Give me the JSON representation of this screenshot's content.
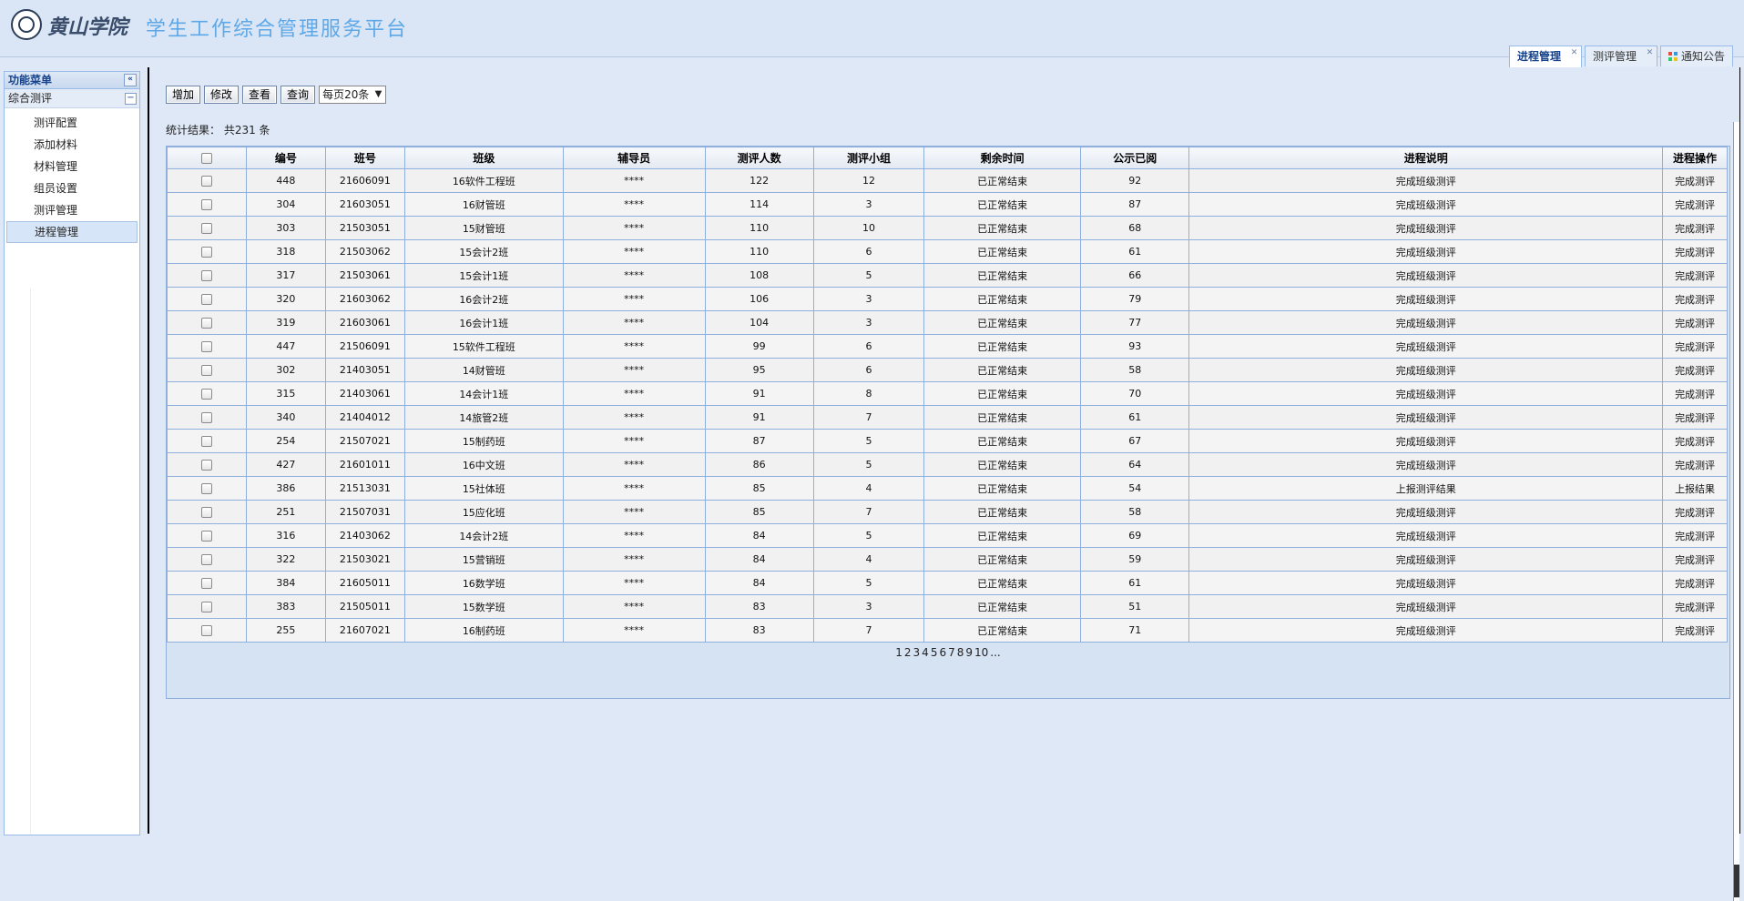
{
  "header": {
    "logo_text": "黄山学院",
    "title": "学生工作综合管理服务平台"
  },
  "tabs": [
    {
      "label": "进程管理",
      "active": true
    },
    {
      "label": "测评管理",
      "active": false
    },
    {
      "label": "通知公告",
      "active": false
    }
  ],
  "sidebar": {
    "title": "功能菜单",
    "group": "综合测评",
    "items": [
      {
        "label": "测评配置"
      },
      {
        "label": "添加材料"
      },
      {
        "label": "材料管理"
      },
      {
        "label": "组员设置"
      },
      {
        "label": "测评管理"
      },
      {
        "label": "进程管理"
      }
    ]
  },
  "toolbar": {
    "add_label": "增加",
    "edit_label": "修改",
    "view_label": "查看",
    "query_label": "查询",
    "page_size": "每页20条"
  },
  "stats": "统计结果： 共231 条",
  "table": {
    "columns": [
      "",
      "编号",
      "班号",
      "班级",
      "辅导员",
      "测评人数",
      "测评小组",
      "剩余时间",
      "公示已阅",
      "进程说明",
      "进程操作"
    ],
    "rows": [
      [
        "448",
        "21606091",
        "16软件工程班",
        "****",
        "122",
        "12",
        "已正常结束",
        "92",
        "完成班级测评",
        "完成测评"
      ],
      [
        "304",
        "21603051",
        "16财管班",
        "****",
        "114",
        "3",
        "已正常结束",
        "87",
        "完成班级测评",
        "完成测评"
      ],
      [
        "303",
        "21503051",
        "15财管班",
        "****",
        "110",
        "10",
        "已正常结束",
        "68",
        "完成班级测评",
        "完成测评"
      ],
      [
        "318",
        "21503062",
        "15会计2班",
        "****",
        "110",
        "6",
        "已正常结束",
        "61",
        "完成班级测评",
        "完成测评"
      ],
      [
        "317",
        "21503061",
        "15会计1班",
        "****",
        "108",
        "5",
        "已正常结束",
        "66",
        "完成班级测评",
        "完成测评"
      ],
      [
        "320",
        "21603062",
        "16会计2班",
        "****",
        "106",
        "3",
        "已正常结束",
        "79",
        "完成班级测评",
        "完成测评"
      ],
      [
        "319",
        "21603061",
        "16会计1班",
        "****",
        "104",
        "3",
        "已正常结束",
        "77",
        "完成班级测评",
        "完成测评"
      ],
      [
        "447",
        "21506091",
        "15软件工程班",
        "****",
        "99",
        "6",
        "已正常结束",
        "93",
        "完成班级测评",
        "完成测评"
      ],
      [
        "302",
        "21403051",
        "14财管班",
        "****",
        "95",
        "6",
        "已正常结束",
        "58",
        "完成班级测评",
        "完成测评"
      ],
      [
        "315",
        "21403061",
        "14会计1班",
        "****",
        "91",
        "8",
        "已正常结束",
        "70",
        "完成班级测评",
        "完成测评"
      ],
      [
        "340",
        "21404012",
        "14旅管2班",
        "****",
        "91",
        "7",
        "已正常结束",
        "61",
        "完成班级测评",
        "完成测评"
      ],
      [
        "254",
        "21507021",
        "15制药班",
        "****",
        "87",
        "5",
        "已正常结束",
        "67",
        "完成班级测评",
        "完成测评"
      ],
      [
        "427",
        "21601011",
        "16中文班",
        "****",
        "86",
        "5",
        "已正常结束",
        "64",
        "完成班级测评",
        "完成测评"
      ],
      [
        "386",
        "21513031",
        "15社体班",
        "****",
        "85",
        "4",
        "已正常结束",
        "54",
        "上报测评结果",
        "上报结果"
      ],
      [
        "251",
        "21507031",
        "15应化班",
        "****",
        "85",
        "7",
        "已正常结束",
        "58",
        "完成班级测评",
        "完成测评"
      ],
      [
        "316",
        "21403062",
        "14会计2班",
        "****",
        "84",
        "5",
        "已正常结束",
        "69",
        "完成班级测评",
        "完成测评"
      ],
      [
        "322",
        "21503021",
        "15营销班",
        "****",
        "84",
        "4",
        "已正常结束",
        "59",
        "完成班级测评",
        "完成测评"
      ],
      [
        "384",
        "21605011",
        "16数学班",
        "****",
        "84",
        "5",
        "已正常结束",
        "61",
        "完成班级测评",
        "完成测评"
      ],
      [
        "383",
        "21505011",
        "15数学班",
        "****",
        "83",
        "3",
        "已正常结束",
        "51",
        "完成班级测评",
        "完成测评"
      ],
      [
        "255",
        "21607021",
        "16制药班",
        "****",
        "83",
        "7",
        "已正常结束",
        "71",
        "完成班级测评",
        "完成测评"
      ]
    ]
  },
  "pager": [
    "1",
    "2",
    "3",
    "4",
    "5",
    "6",
    "7",
    "8",
    "9",
    "10",
    "..."
  ]
}
